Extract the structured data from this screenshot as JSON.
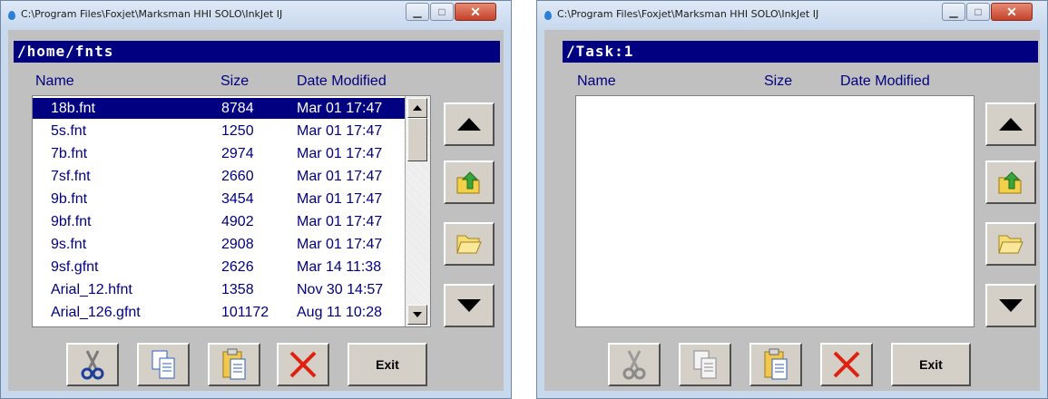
{
  "colors": {
    "accent": "#000080",
    "text": "#000080",
    "selected_bg": "#000080",
    "window_frame": "#c8d9ee",
    "client_bg": "#c0c0c0"
  },
  "columns": {
    "name": "Name",
    "size": "Size",
    "date": "Date Modified"
  },
  "left_window": {
    "title": "C:\\Program Files\\Foxjet\\Marksman HHI SOLO\\InkJet  IJ",
    "path": "/home/fnts",
    "files": [
      {
        "name": "18b.fnt",
        "size": "8784",
        "date": "Mar 01 17:47",
        "selected": true
      },
      {
        "name": "5s.fnt",
        "size": "1250",
        "date": "Mar 01 17:47"
      },
      {
        "name": "7b.fnt",
        "size": "2974",
        "date": "Mar 01 17:47"
      },
      {
        "name": "7sf.fnt",
        "size": "2660",
        "date": "Mar 01 17:47"
      },
      {
        "name": "9b.fnt",
        "size": "3454",
        "date": "Mar 01 17:47"
      },
      {
        "name": "9bf.fnt",
        "size": "4902",
        "date": "Mar 01 17:47"
      },
      {
        "name": "9s.fnt",
        "size": "2908",
        "date": "Mar 01 17:47"
      },
      {
        "name": "9sf.gfnt",
        "size": "2626",
        "date": "Mar 14 11:38"
      },
      {
        "name": "Arial_12.hfnt",
        "size": "1358",
        "date": "Nov 30 14:57"
      },
      {
        "name": "Arial_126.gfnt",
        "size": "101172",
        "date": "Aug 11 10:28"
      }
    ],
    "exit_label": "Exit",
    "icons": [
      "cut-icon",
      "copy-icon",
      "paste-icon",
      "delete-icon",
      "arrow-up-icon",
      "folder-up-icon",
      "folder-open-icon",
      "arrow-down-icon"
    ]
  },
  "right_window": {
    "title": "C:\\Program Files\\Foxjet\\Marksman HHI SOLO\\InkJet  IJ",
    "path": "/Task:1",
    "files": [],
    "exit_label": "Exit"
  }
}
